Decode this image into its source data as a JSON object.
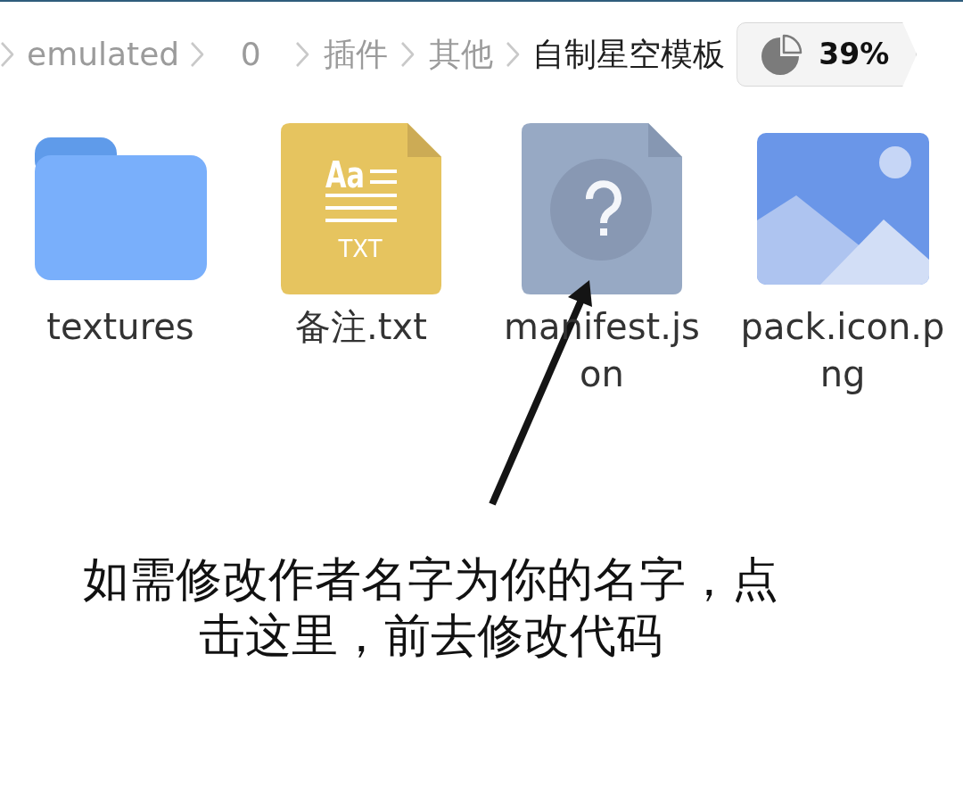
{
  "breadcrumb": [
    {
      "label": "emulated",
      "selected": false
    },
    {
      "label": "0",
      "selected": false
    },
    {
      "label": "插件",
      "selected": false
    },
    {
      "label": "其他",
      "selected": false
    },
    {
      "label": "自制星空模板",
      "selected": true
    }
  ],
  "storage_badge": {
    "usage": "39%"
  },
  "files": [
    {
      "name": "textures",
      "kind": "folder"
    },
    {
      "name": "备注.txt",
      "kind": "text",
      "icon_glyph": "Aa",
      "icon_label": "TXT"
    },
    {
      "name": "manifest.json",
      "kind": "unknown"
    },
    {
      "name": "pack.icon.png",
      "kind": "image"
    }
  ],
  "annotation": {
    "text": "如需修改作者名字为你的名字，点击这里，前去修改代码"
  }
}
